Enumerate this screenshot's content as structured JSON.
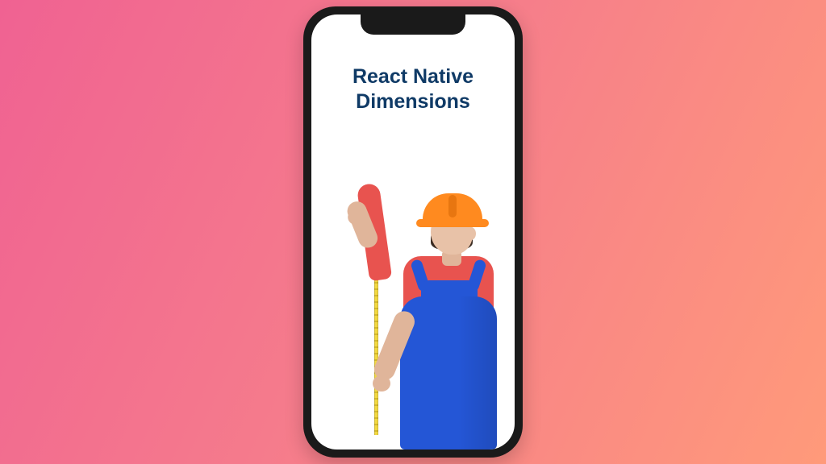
{
  "title": {
    "line1": "React Native",
    "line2": "Dimensions"
  },
  "colors": {
    "title_text": "#0f3a66",
    "phone_frame": "#1a1a1a",
    "gradient_start": "#f06292",
    "gradient_end": "#ff9a7a",
    "overalls": "#2456d6",
    "shirt": "#e8534f",
    "hardhat": "#ff8a1f"
  },
  "illustration": {
    "description": "construction worker in orange hard hat, red t-shirt and blue overalls measuring a wall with a yellow tape measure",
    "icons": {
      "hardhat": "hardhat-icon",
      "tape": "tape-measure-icon"
    }
  }
}
